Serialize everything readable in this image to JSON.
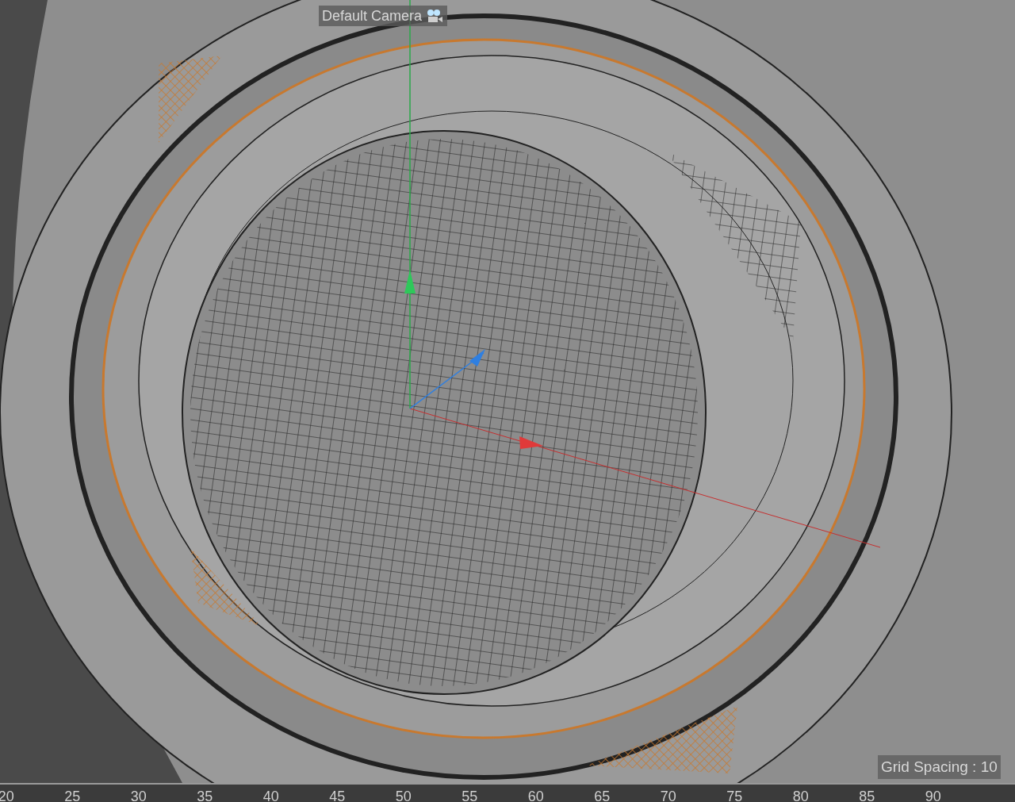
{
  "viewport": {
    "camera_label": "Default Camera",
    "grid_spacing": "Grid Spacing : 10"
  },
  "timeline": {
    "ticks": [
      "20",
      "25",
      "30",
      "35",
      "40",
      "45",
      "50",
      "55",
      "60",
      "65",
      "70",
      "75",
      "80",
      "85",
      "90"
    ]
  }
}
